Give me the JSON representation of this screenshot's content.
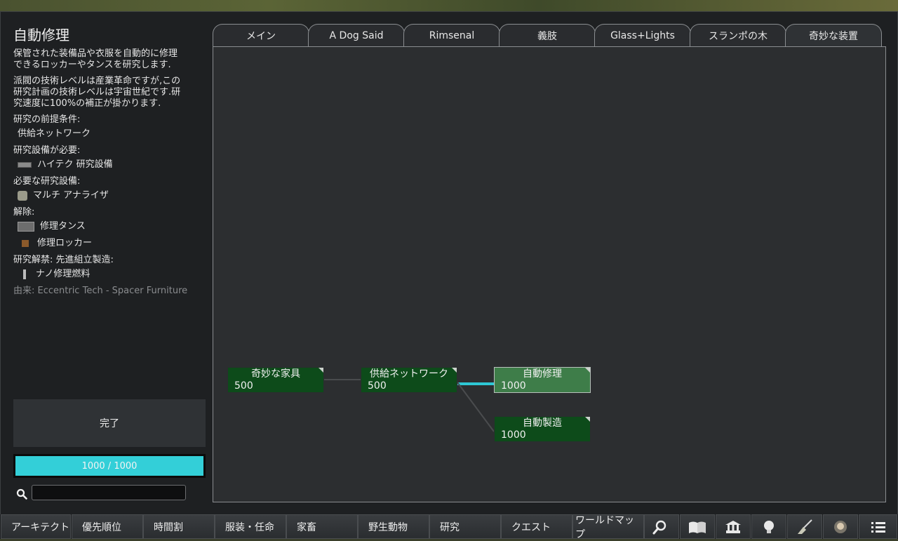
{
  "left": {
    "title": "自動修理",
    "description": "保管された装備品や衣服を自動的に修理\nできるロッカーやタンスを研究します.",
    "tech_note": "派閥の技術レベルは産業革命ですが,この\n研究計画の技術レベルは宇宙世紀です.研\n究速度に100%の補正が掛かります.",
    "prereq_label": "研究の前提条件:",
    "prereq_item": "供給ネットワーク",
    "bench_label": "研究設備が必要:",
    "bench_item": "ハイテク 研究設備",
    "facility_label": "必要な研究設備:",
    "facility_item": "マルチ アナライザ",
    "unlock_label": "解除:",
    "unlock_items": [
      "修理タンス",
      "修理ロッカー"
    ],
    "recipe_label": "研究解禁: 先進組立製造:",
    "recipe_item": "ナノ修理燃料",
    "source": "由来:  Eccentric Tech - Spacer Furniture"
  },
  "done_button": "完了",
  "progress": {
    "text": "1000 / 1000",
    "fraction": 1.0,
    "color": "#33cfd8"
  },
  "search": {
    "value": "",
    "icon": "search-icon"
  },
  "tabs": [
    "メイン",
    "A Dog Said",
    "Rimsenal",
    "義肢",
    "Glass+Lights",
    "スランポの木",
    "奇妙な装置"
  ],
  "active_tab": "奇妙な装置",
  "tree": {
    "nodes": [
      {
        "name": "奇妙な家具",
        "cost": "500"
      },
      {
        "name": "供給ネットワーク",
        "cost": "500"
      },
      {
        "name": "自動修理",
        "cost": "1000",
        "selected": true
      },
      {
        "name": "自動製造",
        "cost": "1000"
      }
    ],
    "link_highlight_color": "#2ec7d4",
    "node_color": "#0d4b1a",
    "selected_color": "#3e7d49"
  },
  "bottombar": {
    "buttons": [
      "アーキテクト",
      "優先順位",
      "時間割",
      "服装・任命",
      "家畜",
      "野生動物",
      "研究",
      "クエスト",
      "ワールドマップ"
    ],
    "icons": [
      "search-icon",
      "book-icon",
      "history-icon",
      "lightbulb-icon",
      "broom-icon",
      "portrait-icon",
      "menu-icon"
    ]
  }
}
